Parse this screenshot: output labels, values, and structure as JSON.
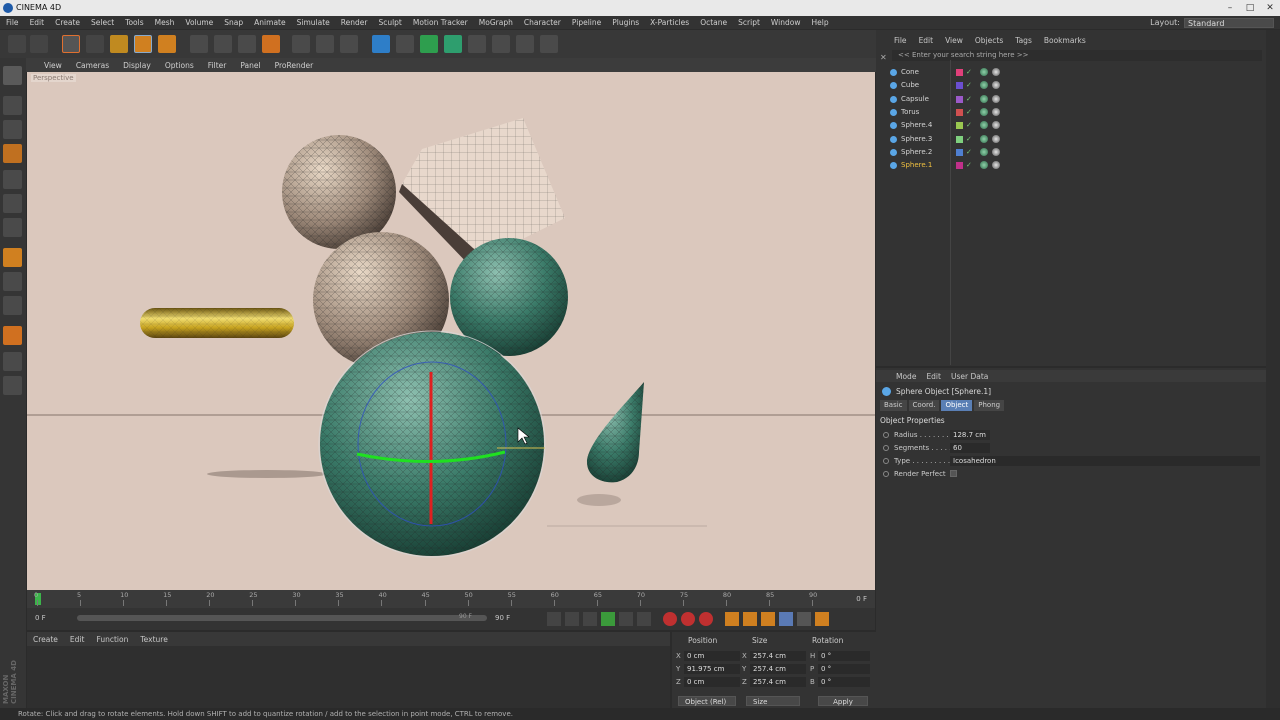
{
  "window": {
    "title": "CINEMA 4D"
  },
  "menubar": {
    "items": [
      "File",
      "Edit",
      "Create",
      "Select",
      "Tools",
      "Mesh",
      "Volume",
      "Snap",
      "Animate",
      "Simulate",
      "Render",
      "Sculpt",
      "Motion Tracker",
      "MoGraph",
      "Character",
      "Pipeline",
      "Plugins",
      "X-Particles",
      "Octane",
      "Script",
      "Window",
      "Help"
    ]
  },
  "layout": {
    "label": "Layout:",
    "value": "Standard"
  },
  "viewport": {
    "menu": [
      "View",
      "Cameras",
      "Display",
      "Options",
      "Filter",
      "Panel",
      "ProRender"
    ],
    "camera_label": "Perspective"
  },
  "timeline": {
    "ticks": [
      "0",
      "5",
      "10",
      "15",
      "20",
      "25",
      "30",
      "35",
      "40",
      "45",
      "50",
      "55",
      "60",
      "65",
      "70",
      "75",
      "80",
      "85",
      "90"
    ],
    "current_frame": "0 F",
    "start_frame": "0 F",
    "end_frame": "90 F",
    "end_frame_small": "90 F"
  },
  "material_manager": {
    "menu": [
      "Create",
      "Edit",
      "Function",
      "Texture"
    ]
  },
  "coordinates": {
    "headers": {
      "position": "Position",
      "size": "Size",
      "rotation": "Rotation"
    },
    "rows": [
      {
        "axis": "X",
        "pos": "0 cm",
        "size_axis": "X",
        "size": "257.4 cm",
        "rot_axis": "H",
        "rot": "0 °"
      },
      {
        "axis": "Y",
        "pos": "91.975 cm",
        "size_axis": "Y",
        "size": "257.4 cm",
        "rot_axis": "P",
        "rot": "0 °"
      },
      {
        "axis": "Z",
        "pos": "0 cm",
        "size_axis": "Z",
        "size": "257.4 cm",
        "rot_axis": "B",
        "rot": "0 °"
      }
    ],
    "mode": "Object (Rel)",
    "size_mode": "Size",
    "apply": "Apply"
  },
  "status": {
    "text": "Rotate: Click and drag to rotate elements. Hold down SHIFT to add to quantize rotation / add to the selection in point mode, CTRL to remove."
  },
  "object_manager": {
    "menu": [
      "File",
      "Edit",
      "View",
      "Objects",
      "Tags",
      "Bookmarks"
    ],
    "search_placeholder": "<< Enter your search string here >>",
    "objects": [
      {
        "name": "Cone",
        "color": "#e0407a"
      },
      {
        "name": "Cube",
        "color": "#6b4fd0"
      },
      {
        "name": "Capsule",
        "color": "#9b5ac8"
      },
      {
        "name": "Torus",
        "color": "#d05050"
      },
      {
        "name": "Sphere.4",
        "color": "#9ac850"
      },
      {
        "name": "Sphere.3",
        "color": "#7fd07f"
      },
      {
        "name": "Sphere.2",
        "color": "#4f7fd0"
      },
      {
        "name": "Sphere.1",
        "color": "#c0308a"
      }
    ],
    "selected_color": "#f0c040"
  },
  "attribute_manager": {
    "menu": [
      "Mode",
      "Edit",
      "User Data"
    ],
    "title": "Sphere Object [Sphere.1]",
    "tabs": [
      "Basic",
      "Coord.",
      "Object",
      "Phong"
    ],
    "active_tab": "Object",
    "section": "Object Properties",
    "fields": [
      {
        "label": "Radius . . . . . . .",
        "value": "128.7 cm"
      },
      {
        "label": "Segments . . . . .",
        "value": "60"
      },
      {
        "label": "Type . . . . . . . . .",
        "value": "Icosahedron"
      },
      {
        "label": "Render Perfect",
        "value": ""
      }
    ]
  },
  "branding": {
    "logo": "MAXON CINEMA 4D"
  }
}
